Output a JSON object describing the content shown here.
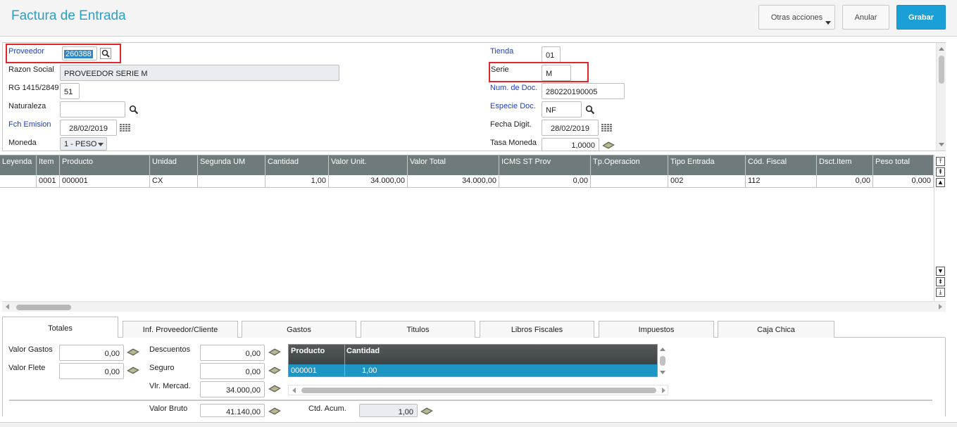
{
  "header": {
    "title": "Factura de Entrada",
    "buttons": {
      "otras": "Otras acciones",
      "anular": "Anular",
      "grabar": "Grabar"
    }
  },
  "form": {
    "proveedor": {
      "label": "Proveedor",
      "value": "260388"
    },
    "razon_social": {
      "label": "Razon Social",
      "value": "PROVEEDOR SERIE M"
    },
    "rg": {
      "label": "RG 1415/2849",
      "value": "51"
    },
    "naturaleza": {
      "label": "Naturaleza",
      "value": ""
    },
    "fch_emision": {
      "label": "Fch Emision",
      "value": "28/02/2019"
    },
    "moneda": {
      "label": "Moneda",
      "value": "1 - PESO"
    },
    "tienda": {
      "label": "Tienda",
      "value": "01"
    },
    "serie": {
      "label": "Serie",
      "value": "M"
    },
    "num_doc": {
      "label": "Num. de Doc.",
      "value": "280220190005"
    },
    "especie_doc": {
      "label": "Especie Doc.",
      "value": "NF"
    },
    "fecha_digit": {
      "label": "Fecha Digit.",
      "value": "28/02/2019"
    },
    "tasa_moneda": {
      "label": "Tasa Moneda",
      "value": "1,0000"
    }
  },
  "grid": {
    "columns": [
      "Leyenda",
      "Item",
      "Producto",
      "Unidad",
      "Segunda UM",
      "Cantidad",
      "Valor Unit.",
      "Valor Total",
      "ICMS ST Prov",
      "Tp.Operacion",
      "Tipo Entrada",
      "Cód. Fiscal",
      "Dsct.Item",
      "Peso total"
    ],
    "rows": [
      [
        "",
        "0001",
        "000001",
        "CX",
        "",
        "1,00",
        "34.000,00",
        "34.000,00",
        "0,00",
        "",
        "002",
        "112",
        "0,00",
        "0,000"
      ]
    ]
  },
  "tabs": [
    "Totales",
    "Inf. Proveedor/Cliente",
    "Gastos",
    "Titulos",
    "Libros Fiscales",
    "Impuestos",
    "Caja Chica"
  ],
  "totales": {
    "valor_gastos": {
      "label": "Valor Gastos",
      "value": "0,00"
    },
    "valor_flete": {
      "label": "Valor Flete",
      "value": "0,00"
    },
    "descuentos": {
      "label": "Descuentos",
      "value": "0,00"
    },
    "seguro": {
      "label": "Seguro",
      "value": "0,00"
    },
    "vlr_mercad": {
      "label": "Vlr. Mercad.",
      "value": "34.000,00"
    },
    "valor_bruto": {
      "label": "Valor Bruto",
      "value": "41.140,00"
    },
    "ctd_acum": {
      "label": "Ctd. Acum.",
      "value": "1,00"
    },
    "mini_grid": {
      "columns": [
        "Producto",
        "Cantidad"
      ],
      "row": [
        "000001",
        "1,00"
      ]
    }
  },
  "colors": {
    "accent": "#2a9fc4",
    "primary_button": "#1a9fd6",
    "highlight": "#e0262b",
    "grid_header": "#6f7a7c",
    "selected_row": "#1f95c3"
  }
}
